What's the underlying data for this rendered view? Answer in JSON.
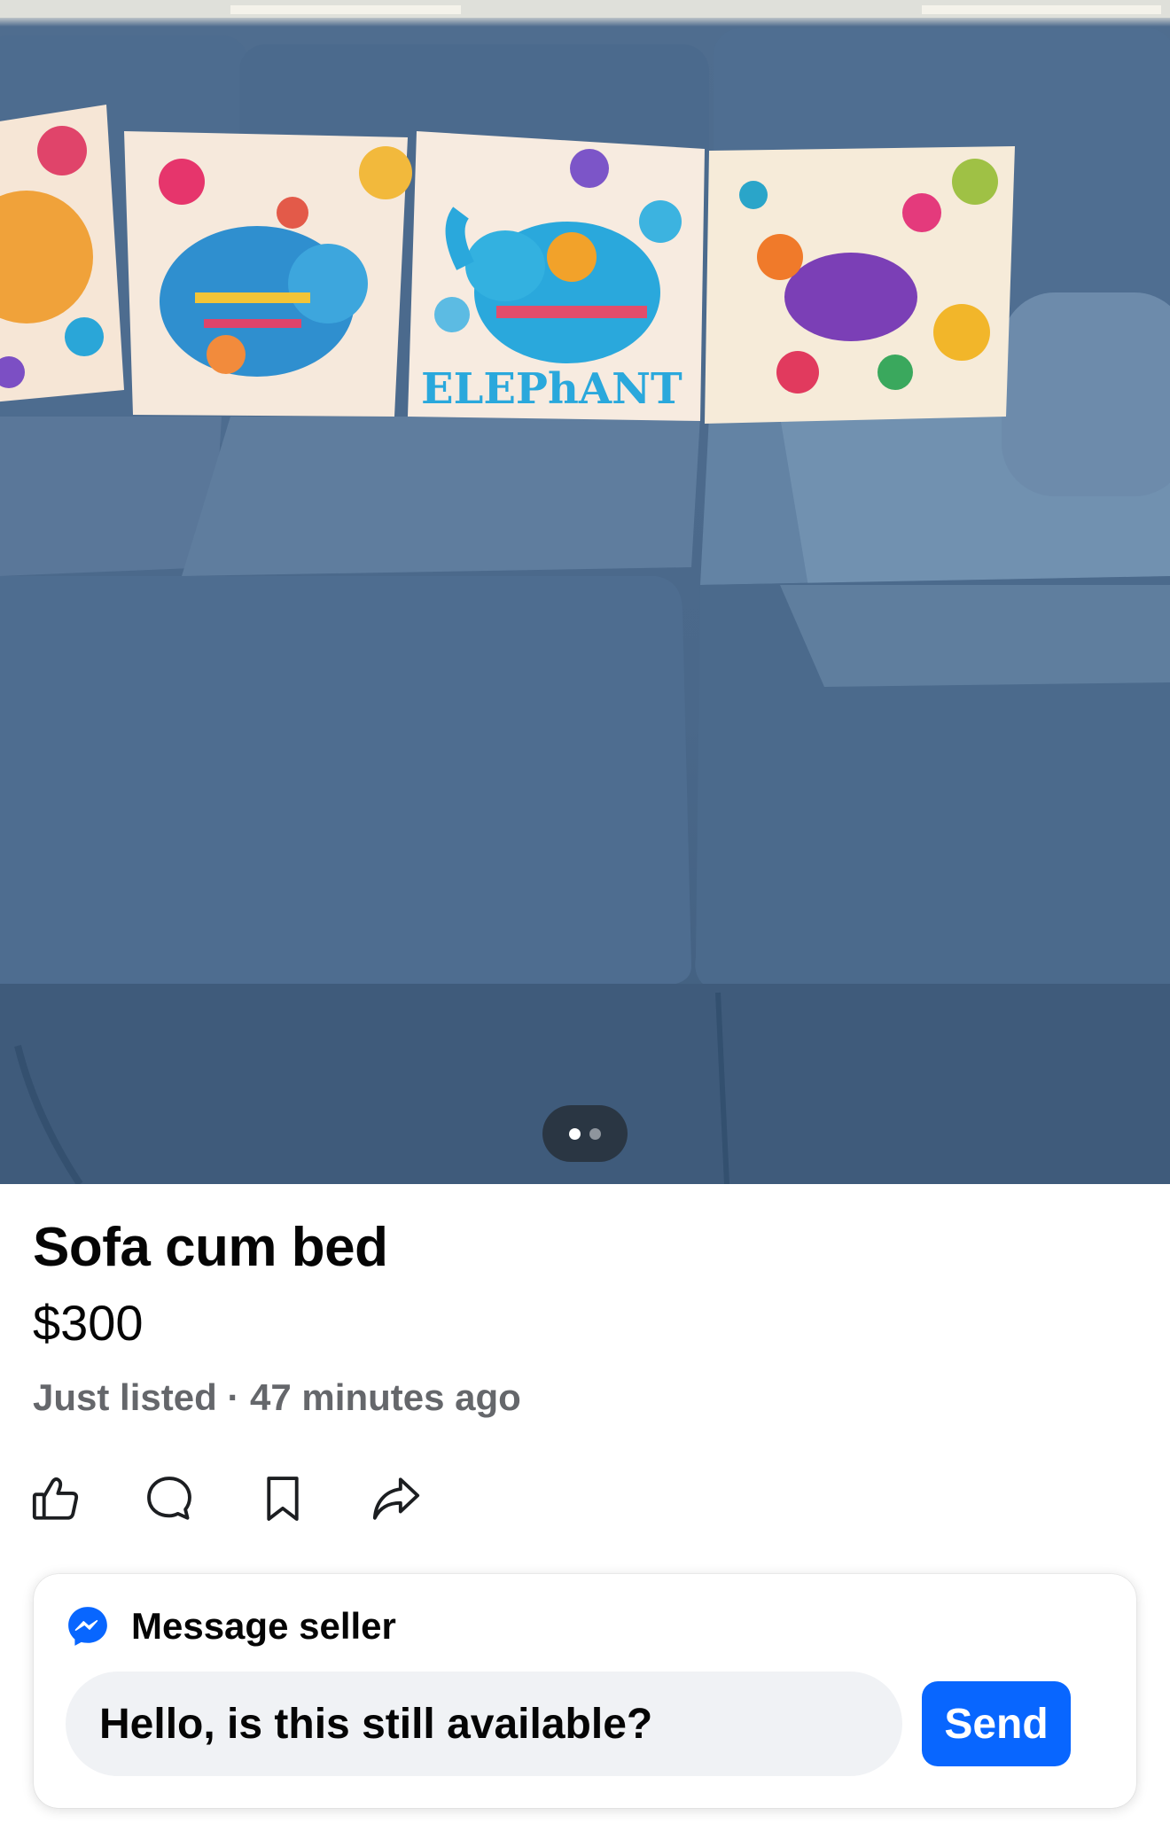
{
  "listing": {
    "photo_alt": "Blue fabric sofa cum bed with four colorful elephant-print cushions",
    "cushion_text": "ELEPhANT",
    "pager": {
      "count": 2,
      "active_index": 0
    },
    "title": "Sofa cum bed",
    "price": "$300",
    "listed": "Just listed · 47 minutes ago"
  },
  "actions": [
    {
      "name": "like-button",
      "icon": "thumbs-up-icon"
    },
    {
      "name": "comment-button",
      "icon": "comment-bubble-icon"
    },
    {
      "name": "save-button",
      "icon": "bookmark-icon"
    },
    {
      "name": "share-button",
      "icon": "share-arrow-icon"
    }
  ],
  "message_card": {
    "icon": "messenger-icon",
    "heading": "Message seller",
    "input_value": "Hello, is this still available?",
    "send_label": "Send"
  },
  "colors": {
    "accent": "#0866ff",
    "input_bg": "#f0f2f5",
    "secondary_text": "#65676b",
    "sofa_blue": "#4a688a"
  }
}
